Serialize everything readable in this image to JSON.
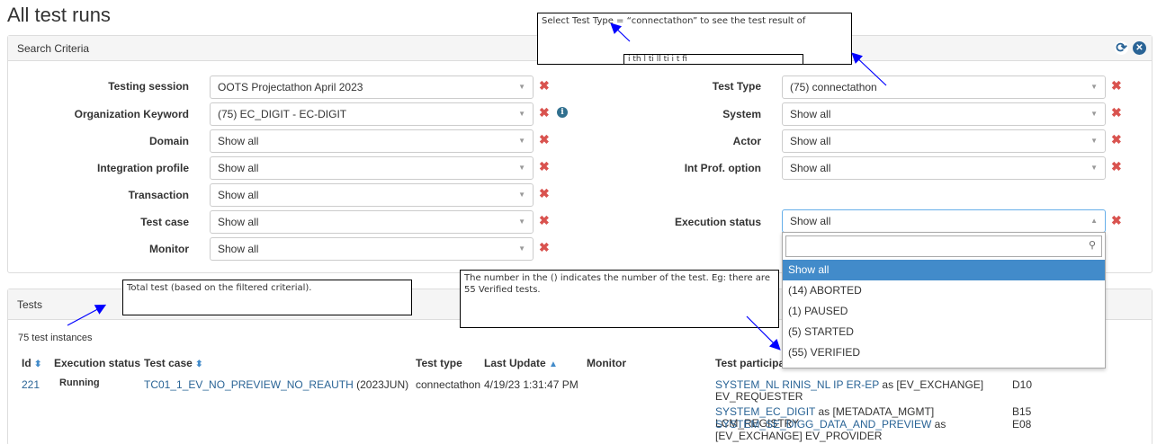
{
  "page_title": "All test runs",
  "search_panel": {
    "title": "Search Criteria",
    "left_filters": [
      {
        "label": "Testing session",
        "value": "OOTS Projectathon April 2023"
      },
      {
        "label": "Organization Keyword",
        "value": "(75) EC_DIGIT - EC-DIGIT"
      },
      {
        "label": "Domain",
        "value": "Show all"
      },
      {
        "label": "Integration profile",
        "value": "Show all"
      },
      {
        "label": "Transaction",
        "value": "Show all"
      },
      {
        "label": "Test case",
        "value": "Show all"
      },
      {
        "label": "Monitor",
        "value": "Show all"
      }
    ],
    "right_filters": [
      {
        "label": "Test Type",
        "value": "(75) connectathon"
      },
      {
        "label": "System",
        "value": "Show all"
      },
      {
        "label": "Actor",
        "value": "Show all"
      },
      {
        "label": "Int Prof. option",
        "value": "Show all"
      },
      {
        "label": "Execution status",
        "value": "Show all"
      }
    ],
    "dropdown_options": [
      "Show all",
      "(14) ABORTED",
      "(1) PAUSED",
      "(5) STARTED",
      "(55) VERIFIED"
    ]
  },
  "tests_panel": {
    "title": "Tests",
    "count_text": "75 test instances",
    "columns": [
      "Id",
      "Execution status",
      "Test case",
      "Test type",
      "Last Update",
      "Monitor",
      "Test participan"
    ],
    "row": {
      "id": "221",
      "status": "Running",
      "test_case": "TC01_1_EV_NO_PREVIEW_NO_REAUTH",
      "test_case_suffix": "(2023JUN)",
      "test_type": "connectathon",
      "last_update": "4/19/23 1:31:47 PM",
      "participants": [
        {
          "system": "SYSTEM_NL RINIS_NL IP ER-EP",
          "role": "as [EV_EXCHANGE]",
          "role2": "EV_REQUESTER",
          "table": "D10"
        },
        {
          "system": "SYSTEM_EC_DIGIT",
          "role": "as [METADATA_MGMT] LCM_REGISTRY",
          "role2": "",
          "table": "B15"
        },
        {
          "system": "SYSTEM_SE_DIGG_DATA_AND_PREVIEW",
          "role": "as",
          "role2": "[EV_EXCHANGE] EV_PROVIDER",
          "table": "E08"
        }
      ]
    }
  },
  "callouts": {
    "test_type": "Select Test Type = “connectathon” to see the test result of",
    "test_type_cut": "i    th         l   ti         ll  ti i    t    fi",
    "total": "Total test (based on the filtered criterial).",
    "number": "The number in the () indicates the number of the test. Eg: there are 55 Verified tests."
  },
  "colors": {
    "link": "#2a6496",
    "accent": "#428bca",
    "danger": "#d9534f",
    "arrow": "#0000ff"
  }
}
